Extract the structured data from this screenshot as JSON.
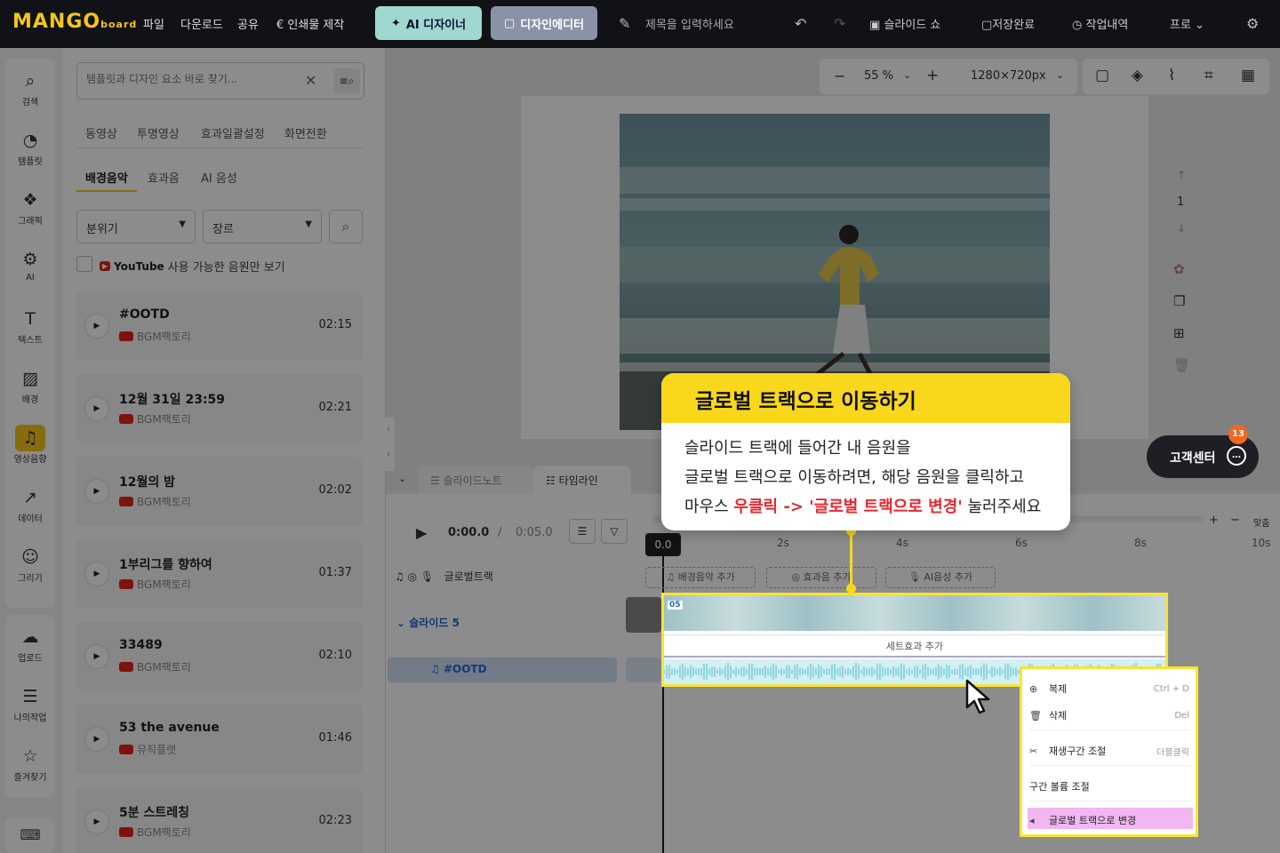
{
  "app": {
    "logo_main": "MANGO",
    "logo_sub": "board",
    "menu": [
      "파일",
      "다운로드",
      "공유",
      "인쇄물 제작"
    ],
    "ai_designer": "AI 디자이너",
    "design_editor": "디자인에디터",
    "title_placeholder": "제목을 입력하세요",
    "slideshow": "슬라이드 쇼",
    "save_status": "저장완료",
    "history": "작업내역",
    "plan": "프로"
  },
  "rail": {
    "items": [
      {
        "label": "검색",
        "icon": "search-icon"
      },
      {
        "label": "템플릿",
        "icon": "template-icon"
      },
      {
        "label": "그래픽",
        "icon": "graphic-icon"
      },
      {
        "label": "AI",
        "icon": "ai-icon"
      },
      {
        "label": "텍스트",
        "icon": "text-icon"
      },
      {
        "label": "배경",
        "icon": "background-icon"
      },
      {
        "label": "영상음향",
        "icon": "media-icon"
      },
      {
        "label": "데이터",
        "icon": "chart-icon"
      },
      {
        "label": "그리기",
        "icon": "draw-icon"
      }
    ],
    "items2": [
      {
        "label": "업로드",
        "icon": "upload-icon"
      },
      {
        "label": "나의작업",
        "icon": "my-work-icon"
      },
      {
        "label": "즐겨찾기",
        "icon": "favorite-icon"
      }
    ]
  },
  "panel": {
    "search_placeholder": "템플릿과 디자인 요소 바로 찾기...",
    "tabs1": [
      "동영상",
      "투명영상",
      "효과일괄설정",
      "화면전환"
    ],
    "tabs2": [
      "배경음악",
      "효과음",
      "AI 음성"
    ],
    "mood": "분위기",
    "genre": "장르",
    "youtube_label": "YouTube",
    "youtube_filter": "사용 가능한 음원만 보기",
    "tracks": [
      {
        "name": "#OOTD",
        "source": "BGM팩토리",
        "duration": "02:15"
      },
      {
        "name": "12월 31일 23:59",
        "source": "BGM팩토리",
        "duration": "02:21"
      },
      {
        "name": "12월의 밤",
        "source": "BGM팩토리",
        "duration": "02:02"
      },
      {
        "name": "1부리그를 향하여",
        "source": "BGM팩토리",
        "duration": "01:37"
      },
      {
        "name": "33489",
        "source": "BGM팩토리",
        "duration": "02:10"
      },
      {
        "name": "53 the avenue",
        "source": "뮤직플랫",
        "duration": "01:46"
      },
      {
        "name": "5분 스트레칭",
        "source": "BGM팩토리",
        "duration": "02:23"
      }
    ]
  },
  "canvas": {
    "zoom": "55 %",
    "size": "1280×720px",
    "page_number": "1"
  },
  "timeline": {
    "tab_notes": "슬라이드노트",
    "tab_timeline": "타임라인",
    "current_time": "0:00.0",
    "total_time": "0:05.0",
    "playhead": "0.0",
    "ticks": [
      "2s",
      "4s",
      "6s",
      "8s",
      "10s"
    ],
    "fit": "맞춤",
    "global_track": "글로벌트랙",
    "add_bgm": "배경음악 추가",
    "add_sfx": "효과음 추가",
    "add_ai_voice": "AI음성 추가",
    "slide_label": "슬라이드 5",
    "audio_chip": "#OOTD",
    "clip_index": "05",
    "clip_add_effect": "세트효과 추가"
  },
  "callout": {
    "title": "글로벌 트랙으로 이동하기",
    "line1": "슬라이드 트랙에 들어간 내 음원을",
    "line2": "글로벌 트랙으로 이동하려면, 해당 음원을 클릭하고",
    "line3_pre": "마우스 ",
    "line3_red": "우클릭 -> '글로벌 트랙으로 변경'",
    "line3_post": " 눌러주세요"
  },
  "context_menu": {
    "copy": "복제",
    "copy_shortcut": "Ctrl + D",
    "delete": "삭제",
    "delete_shortcut": "Del",
    "trim": "재생구간 조절",
    "trim_shortcut": "더블클릭",
    "volume": "구간 볼륨 조절",
    "to_global": "글로벌 트랙으로 변경"
  },
  "help": {
    "label": "고객센터",
    "badge": "13"
  },
  "colors": {
    "accent_yellow": "#f9d71c",
    "highlight_pink": "#f1b7f1",
    "red": "#e8262f"
  }
}
